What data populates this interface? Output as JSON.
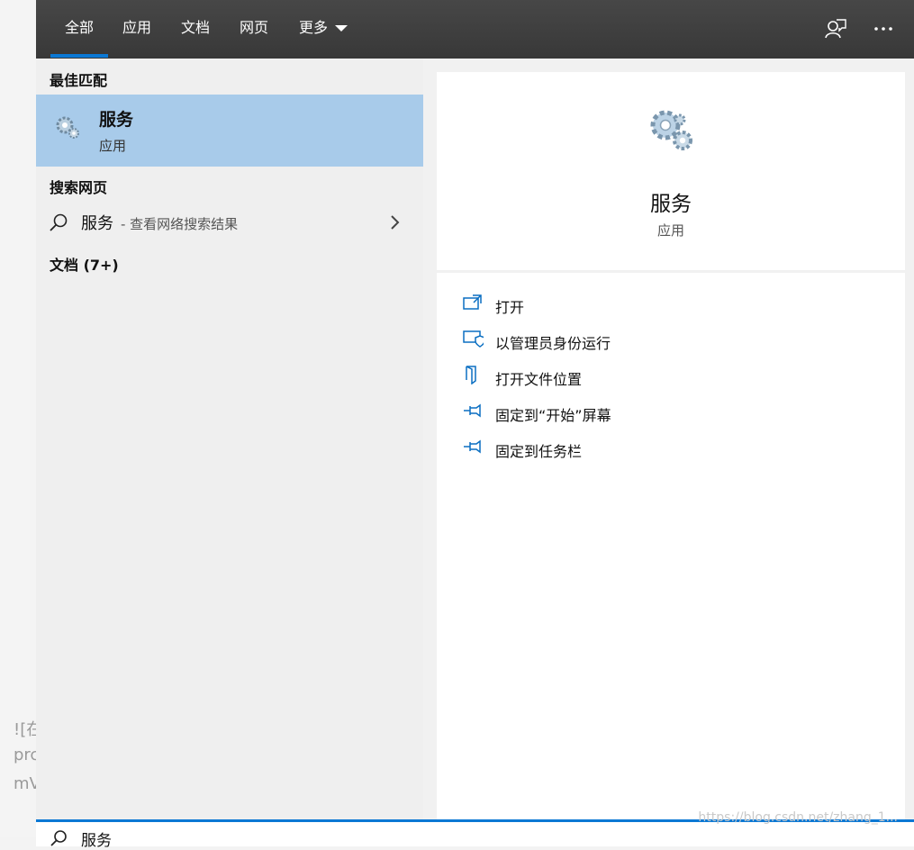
{
  "background": {
    "fragments": [
      "![在",
      "prc",
      "mV"
    ]
  },
  "topbar": {
    "tabs": [
      {
        "label": "全部",
        "active": true
      },
      {
        "label": "应用",
        "active": false
      },
      {
        "label": "文档",
        "active": false
      },
      {
        "label": "网页",
        "active": false
      },
      {
        "label": "更多",
        "active": false
      }
    ],
    "icons": [
      "feedback-icon",
      "more-options-icon"
    ]
  },
  "results": {
    "best_match_title": "最佳匹配",
    "best_match": {
      "name": "服务",
      "kind": "应用",
      "icon": "gears-icon"
    },
    "web_title": "搜索网页",
    "web_item": {
      "query": "服务",
      "hint": "- 查看网络搜索结果"
    },
    "docs_title": "文档 (7+)"
  },
  "preview": {
    "name": "服务",
    "kind": "应用",
    "actions": [
      {
        "label": "打开",
        "icon": "open-icon"
      },
      {
        "label": "以管理员身份运行",
        "icon": "run-as-admin-icon"
      },
      {
        "label": "打开文件位置",
        "icon": "file-location-icon"
      },
      {
        "label": "固定到“开始”屏幕",
        "icon": "pin-icon"
      },
      {
        "label": "固定到任务栏",
        "icon": "pin-icon"
      }
    ]
  },
  "search": {
    "value": "服务"
  },
  "watermark": "https://blog.csdn.net/zhang_1..."
}
